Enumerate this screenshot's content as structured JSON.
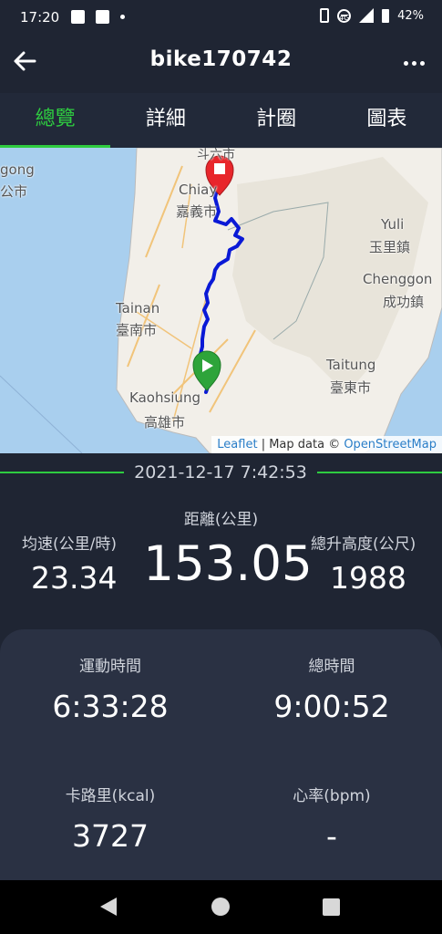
{
  "status_bar": {
    "time": "17:20",
    "network": "4G",
    "battery": "42%",
    "icons": [
      "image-icon",
      "message-icon",
      "dot-icon",
      "vibrate-icon",
      "dnd-icon",
      "signal-icon",
      "battery-icon"
    ]
  },
  "app_bar": {
    "title": "bike170742",
    "back_icon": "arrow-left-icon",
    "more_icon": "more-vertical-dots-icon"
  },
  "tabs": [
    {
      "label": "總覽",
      "active": true
    },
    {
      "label": "詳細",
      "active": false
    },
    {
      "label": "計圈",
      "active": false
    },
    {
      "label": "圖表",
      "active": false
    }
  ],
  "map": {
    "labels": {
      "gong": "gong",
      "gong_cn": "公市",
      "chiayi": "Chiay",
      "chiayi_cn": "嘉義市",
      "top_cn": "斗六市",
      "yuli": "Yuli",
      "yuli_cn": "玉里鎮",
      "chenggong": "Chenggon",
      "chenggong_cn": "成功鎮",
      "tainan": "Tainan",
      "tainan_cn": "臺南市",
      "taitung": "Taitung",
      "taitung_cn": "臺東市",
      "kaohsiung": "Kaohsiung",
      "kaohsiung_cn": "高雄市"
    },
    "attribution": {
      "leaflet": "Leaflet",
      "sep": " | Map data © ",
      "osm": "OpenStreetMap"
    },
    "route_color": "#0a19d6",
    "start_marker_color": "#2ea43a",
    "end_marker_color": "#e8262b"
  },
  "summary": {
    "datetime": "2021-12-17 7:42:53",
    "distance_label": "距離(公里)",
    "distance_value": "153.05",
    "avg_speed_label": "均速(公里/時)",
    "avg_speed_value": "23.34",
    "elevation_label": "總升高度(公尺)",
    "elevation_value": "1988"
  },
  "stats": {
    "moving_time_label": "運動時間",
    "moving_time_value": "6:33:28",
    "total_time_label": "總時間",
    "total_time_value": "9:00:52",
    "calories_label": "卡路里(kcal)",
    "calories_value": "3727",
    "heart_rate_label": "心率(bpm)",
    "heart_rate_value": "-"
  },
  "colors": {
    "accent": "#2ecc40",
    "background": "#1f2533",
    "card": "#2a3143"
  }
}
